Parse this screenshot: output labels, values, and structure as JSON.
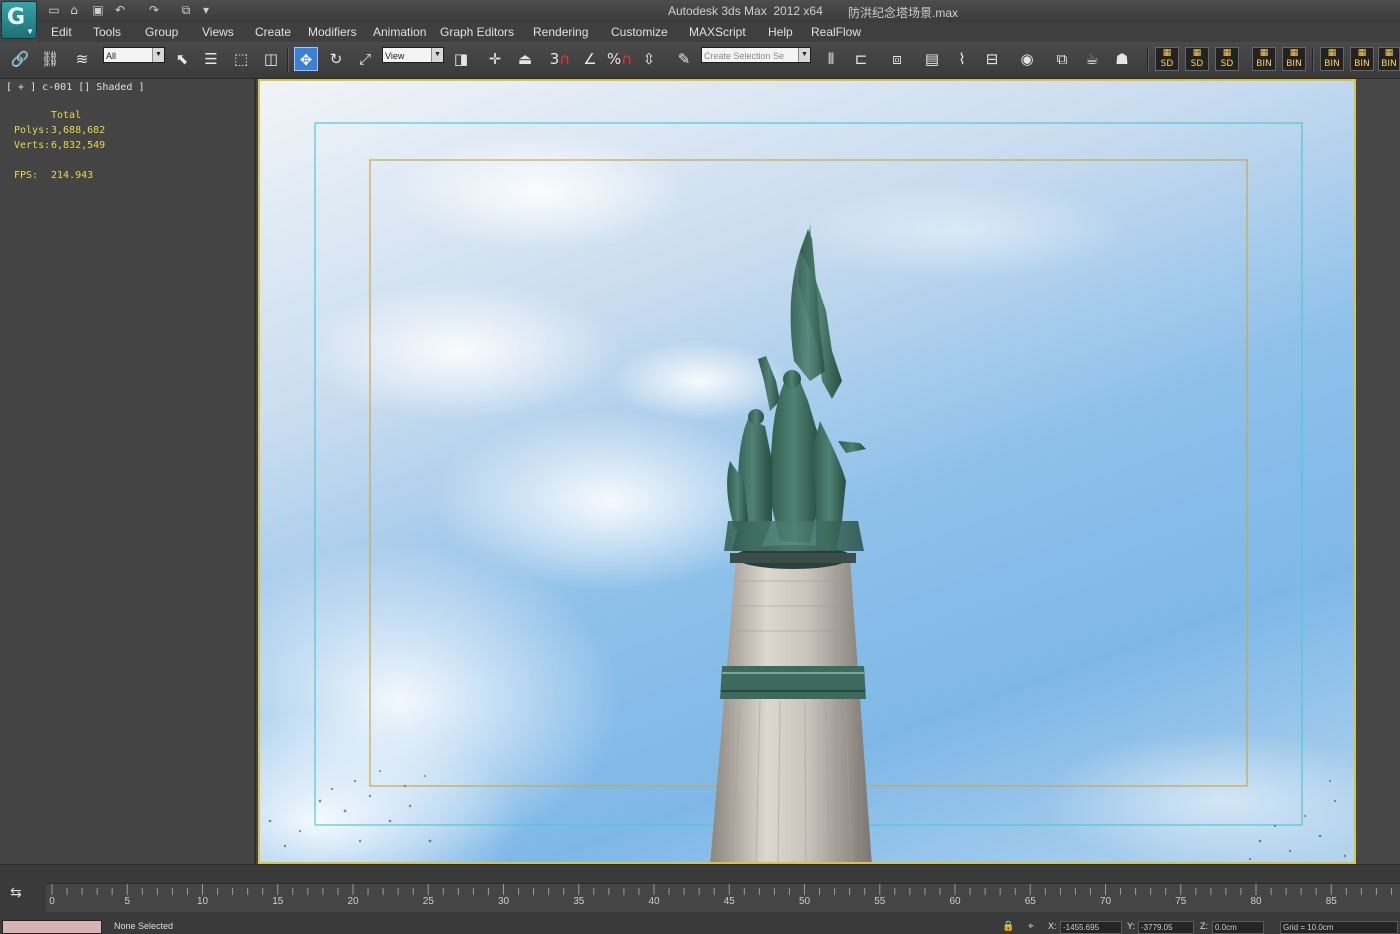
{
  "window": {
    "title": "Autodesk 3ds Max  2012 x64",
    "filename": "防洪纪念塔场景.max",
    "logo_icon": "3ds-max-logo-icon"
  },
  "quick_access": [
    "new-file-icon",
    "open-file-icon",
    "save-icon",
    "undo-icon",
    "redo-icon",
    "project-folder-icon"
  ],
  "menu": [
    "Edit",
    "Tools",
    "Group",
    "Views",
    "Create",
    "Modifiers",
    "Animation",
    "Graph Editors",
    "Rendering",
    "Customize",
    "MAXScript",
    "Help",
    "RealFlow"
  ],
  "toolbar": {
    "selection_filter": "All",
    "reference_coord": "View",
    "named_selection_placeholder": "Create Selection Se",
    "snap_label": "3",
    "percent_snap_label": "%"
  },
  "left_viewport": {
    "label": "[ + ] c-001 [] Shaded ]",
    "stats": {
      "total_label": "Total",
      "polys_label": "Polys:",
      "polys_value": "3,688,682",
      "verts_label": "Verts:",
      "verts_value": "6,832,549",
      "fps_label": "FPS:",
      "fps_value": "214.943"
    }
  },
  "timeline": {
    "ticks": [
      "0",
      "5",
      "10",
      "15",
      "20",
      "25",
      "30",
      "35",
      "40",
      "45",
      "50",
      "55",
      "60",
      "65",
      "70",
      "75",
      "80",
      "85"
    ]
  },
  "status": {
    "selection_text": "None Selected",
    "x_label": "X:",
    "x_value": "-1455.695",
    "y_label": "Y:",
    "y_value": "-3779.05",
    "z_label": "Z:",
    "z_value": "0.0cm",
    "grid_text": "Grid = 10.0cm"
  },
  "colors": {
    "safe_frame_outer": "#4fc9d6",
    "safe_frame_inner": "#c9a94a",
    "viewport_border": "#d6c54a",
    "statue_bronze": "#3f6f62",
    "column_stone": "#c8c4bc"
  }
}
